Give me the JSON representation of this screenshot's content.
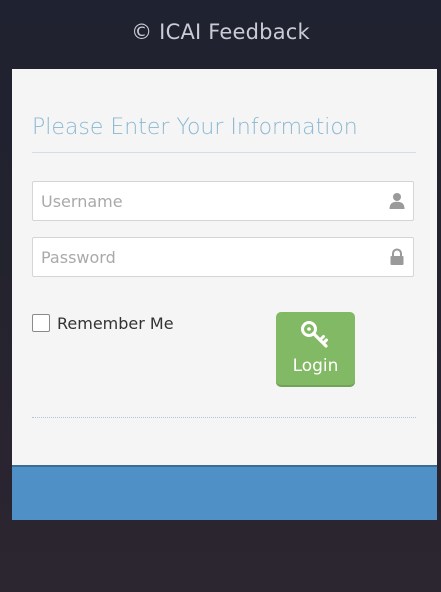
{
  "app": {
    "title": "© ICAI Feedback"
  },
  "form": {
    "heading": "Please Enter Your Information",
    "username": {
      "placeholder": "Username",
      "value": "",
      "icon": "user-icon"
    },
    "password": {
      "placeholder": "Password",
      "value": "",
      "icon": "lock-icon"
    },
    "remember_me": {
      "label": "Remember Me",
      "checked": false
    },
    "login_button": {
      "label": "Login",
      "icon": "key-icon"
    }
  },
  "colors": {
    "heading": "#8ab8d2",
    "login_button": "#82b964",
    "footer_bar": "#4f91c6",
    "card_background": "#f5f5f5"
  }
}
